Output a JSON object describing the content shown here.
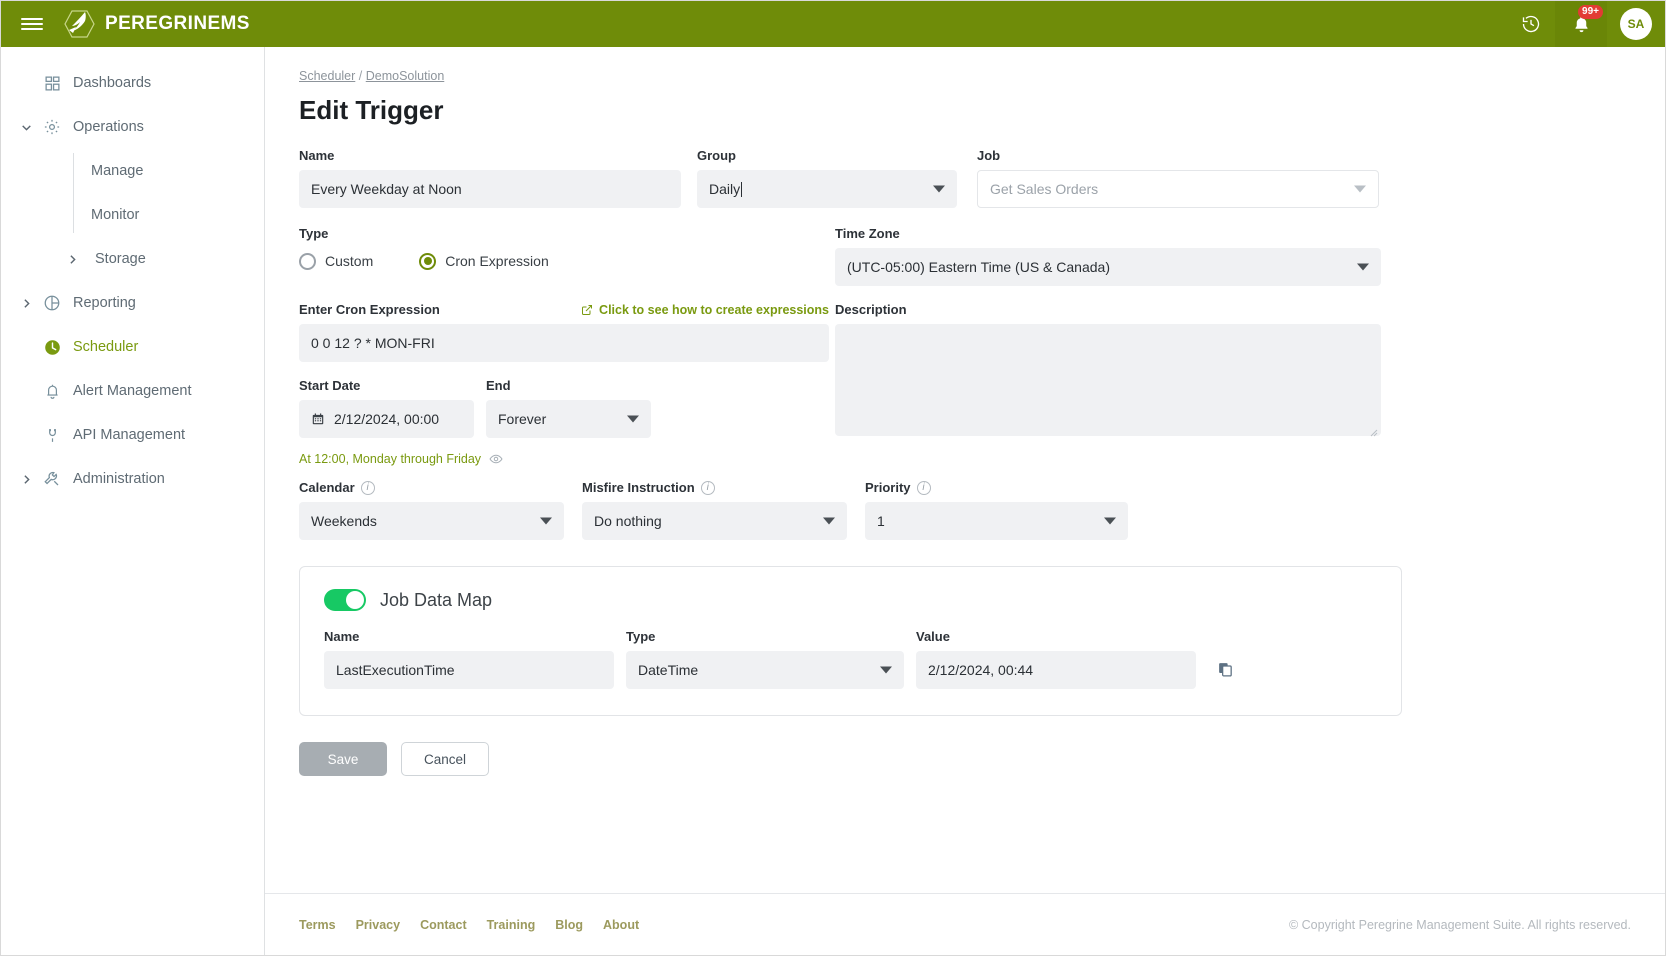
{
  "header": {
    "brand": "PEREGRINEMS",
    "menu_icon": "hamburger-menu-icon",
    "history_icon": "history-clock-icon",
    "notifications_icon": "bell-icon",
    "notifications_badge": "99+",
    "avatar_initials": "SA",
    "brand_color": "#6f8c09"
  },
  "sidebar": {
    "items": [
      {
        "label": "Dashboards",
        "icon": "dashboard-grid-icon",
        "expandable": false,
        "active": false
      },
      {
        "label": "Operations",
        "icon": "gear-icon",
        "expandable": true,
        "expanded": true,
        "active": false
      },
      {
        "label": "Reporting",
        "icon": "pie-chart-icon",
        "expandable": true,
        "expanded": false,
        "active": false
      },
      {
        "label": "Scheduler",
        "icon": "clock-icon",
        "expandable": false,
        "active": true
      },
      {
        "label": "Alert Management",
        "icon": "bell-icon",
        "expandable": false,
        "active": false
      },
      {
        "label": "API Management",
        "icon": "plug-icon",
        "expandable": false,
        "active": false
      },
      {
        "label": "Administration",
        "icon": "wrench-icon",
        "expandable": true,
        "expanded": false,
        "active": false
      }
    ],
    "operations_children": [
      {
        "label": "Manage"
      },
      {
        "label": "Monitor"
      }
    ],
    "storage": {
      "label": "Storage",
      "icon": "chevron-right-icon"
    }
  },
  "breadcrumb": {
    "root": "Scheduler",
    "separator": "/",
    "current": "DemoSolution"
  },
  "page": {
    "title": "Edit Trigger"
  },
  "form": {
    "name": {
      "label": "Name",
      "value": "Every Weekday at Noon"
    },
    "group": {
      "label": "Group",
      "value": "Daily"
    },
    "job": {
      "label": "Job",
      "value": "Get Sales Orders",
      "disabled": true
    },
    "type": {
      "label": "Type",
      "options": [
        "Custom",
        "Cron Expression"
      ],
      "selected": "Cron Expression"
    },
    "time_zone": {
      "label": "Time Zone",
      "value": "(UTC-05:00) Eastern Time (US & Canada)"
    },
    "cron": {
      "label": "Enter Cron Expression",
      "value": "0 0 12 ? * MON-FRI",
      "help_link": "Click to see how to create expressions",
      "help_icon": "external-link-icon",
      "description": "At 12:00, Monday through Friday",
      "description_icon": "eye-icon"
    },
    "description": {
      "label": "Description",
      "value": "",
      "placeholder": ""
    },
    "start_date": {
      "label": "Start Date",
      "value": "2/12/2024, 00:00",
      "icon": "calendar-icon"
    },
    "end": {
      "label": "End",
      "value": "Forever"
    },
    "calendar": {
      "label": "Calendar",
      "value": "Weekends",
      "info_icon": "info-icon"
    },
    "misfire": {
      "label": "Misfire Instruction",
      "value": "Do nothing",
      "info_icon": "info-icon"
    },
    "priority": {
      "label": "Priority",
      "value": "1",
      "info_icon": "info-icon"
    }
  },
  "job_data_map": {
    "title": "Job Data Map",
    "enabled": true,
    "toggle_color": "#17c964",
    "columns": {
      "name": "Name",
      "type": "Type",
      "value": "Value"
    },
    "rows": [
      {
        "name": "LastExecutionTime",
        "type": "DateTime",
        "value": "2/12/2024, 00:44",
        "copy_icon": "copy-icon"
      }
    ]
  },
  "actions": {
    "save": "Save",
    "cancel": "Cancel",
    "save_disabled": true
  },
  "footer": {
    "links": [
      "Terms",
      "Privacy",
      "Contact",
      "Training",
      "Blog",
      "About"
    ],
    "copyright": "© Copyright Peregrine Management Suite. All rights reserved."
  }
}
